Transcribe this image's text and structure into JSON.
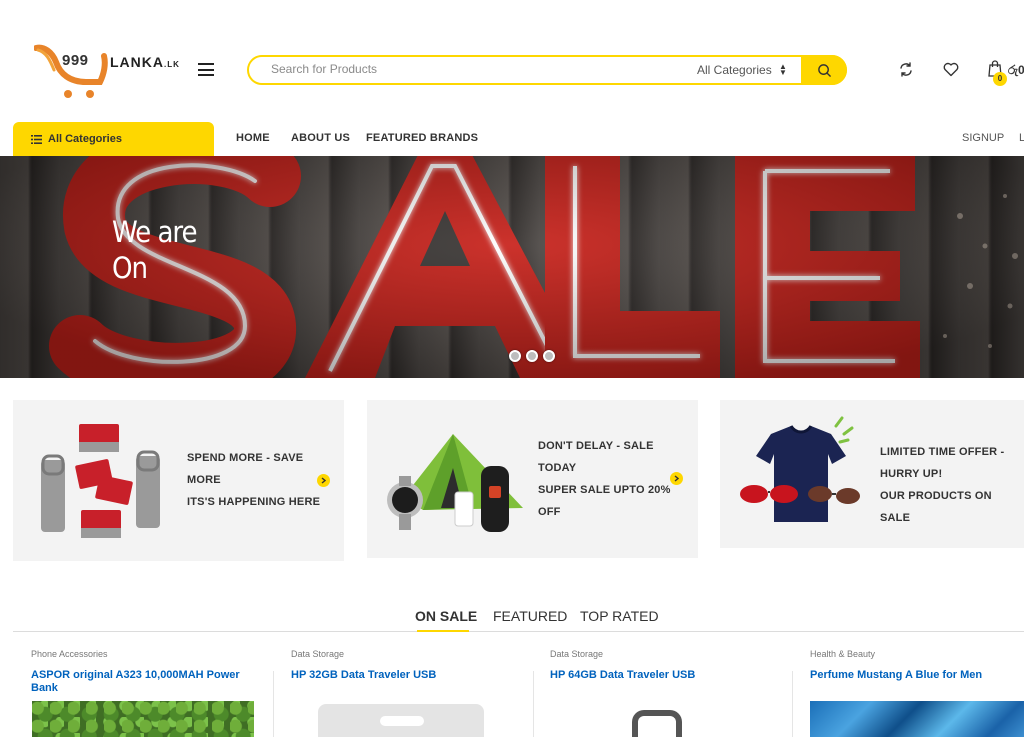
{
  "brand": {
    "logo_number": "999",
    "logo_name": "LANKA",
    "logo_suffix": ".LK"
  },
  "search": {
    "placeholder": "Search for Products",
    "category_selected": "All Categories"
  },
  "header": {
    "cart_count": "0",
    "cart_total": "රු0"
  },
  "nav": {
    "all_categories_label": "All Categories",
    "links": [
      "HOME",
      "ABOUT US",
      "FEATURED BRANDS"
    ],
    "signup": "SIGNUP",
    "login_partial": "L"
  },
  "hero": {
    "headline_line1": "We are",
    "headline_line2": "On",
    "sign_text": "SALE",
    "slide_count": 3,
    "active_slide": 0
  },
  "promos": [
    {
      "lines": [
        "SPEND MORE - SAVE",
        "MORE",
        "ITS'S HAPPENING HERE"
      ]
    },
    {
      "lines": [
        "DON'T DELAY - SALE",
        "TODAY",
        "SUPER SALE UPTO 20%",
        "OFF"
      ]
    },
    {
      "lines": [
        "LIMITED TIME OFFER -",
        "HURRY UP!",
        "OUR PRODUCTS ON SALE"
      ]
    }
  ],
  "tabs": [
    "ON SALE",
    "FEATURED",
    "TOP RATED"
  ],
  "products": [
    {
      "category": "Phone Accessories",
      "title_line1": "ASPOR original A323 10,000MAH Power",
      "title_line2": "Bank"
    },
    {
      "category": "Data Storage",
      "title_line1": "HP 32GB Data Traveler USB",
      "title_line2": ""
    },
    {
      "category": "Data Storage",
      "title_line1": "HP 64GB Data Traveler USB",
      "title_line2": ""
    },
    {
      "category": "Health & Beauty",
      "title_line1": "Perfume Mustang A Blue for Men",
      "title_line2": ""
    }
  ],
  "colors": {
    "accent": "#fed700",
    "link": "#0062bd",
    "text": "#333e48"
  }
}
